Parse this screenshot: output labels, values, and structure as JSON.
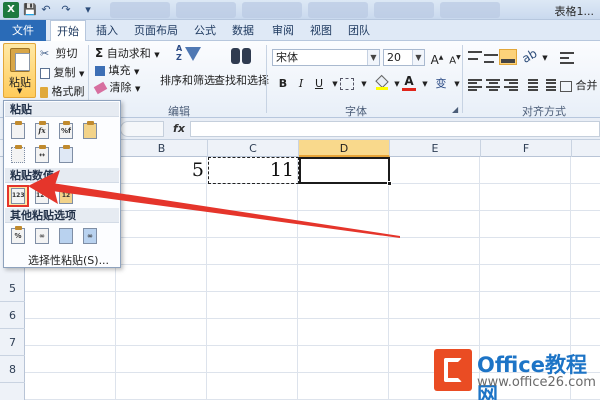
{
  "titlebar": {
    "app_icon": "X",
    "window_title": "表格1...",
    "qat_icons": [
      "save-icon",
      "undo-icon",
      "redo-icon",
      "customize-qat-icon"
    ]
  },
  "tabs": {
    "file": "文件",
    "items": [
      "开始",
      "插入",
      "页面布局",
      "公式",
      "数据",
      "审阅",
      "视图",
      "团队"
    ],
    "active": "开始"
  },
  "ribbon": {
    "clipboard": {
      "paste": "粘贴",
      "cut": "剪切",
      "copy": "复制",
      "format_painter": "格式刷"
    },
    "editing": {
      "autosum": "自动求和",
      "fill": "填充",
      "clear": "清除",
      "sort_filter": "排序和筛选",
      "find_select": "查找和选择",
      "group_label": "编辑"
    },
    "font": {
      "font_name": "宋体",
      "font_size": "20",
      "bold": "B",
      "italic": "I",
      "underline": "U",
      "font_color_glyph": "A",
      "wen_glyph": "变",
      "group_label": "字体"
    },
    "alignment": {
      "merge": "合并",
      "group_label": "对齐方式"
    }
  },
  "formula_bar": {
    "fx": "fx",
    "content": ""
  },
  "grid": {
    "columns": [
      "B",
      "C",
      "D",
      "E",
      "F"
    ],
    "selected_column": "D",
    "rows": [
      "5",
      "6",
      "7",
      "8"
    ],
    "cells": {
      "B1": "5",
      "C1": "11"
    }
  },
  "paste_menu": {
    "section_paste": "粘贴",
    "section_paste_values": "粘贴数值",
    "section_other": "其他粘贴选项",
    "paste_special": "选择性粘贴(S)...",
    "values_button_label": "123",
    "paste_icons": [
      "paste-icon",
      "paste-formulas-icon",
      "paste-formulas-number-format-icon",
      "keep-source-formatting-icon",
      "no-borders-icon",
      "keep-column-widths-icon",
      "transpose-icon"
    ],
    "value_icons": [
      "paste-values-icon",
      "values-number-format-icon",
      "values-source-format-icon"
    ],
    "other_icons": [
      "formatting-icon",
      "paste-link-icon",
      "picture-icon",
      "linked-picture-icon"
    ]
  },
  "annotation": {
    "arrow_color": "#e5352b"
  },
  "watermark": {
    "brand": "Office教程网",
    "url": "www.office26.com"
  }
}
